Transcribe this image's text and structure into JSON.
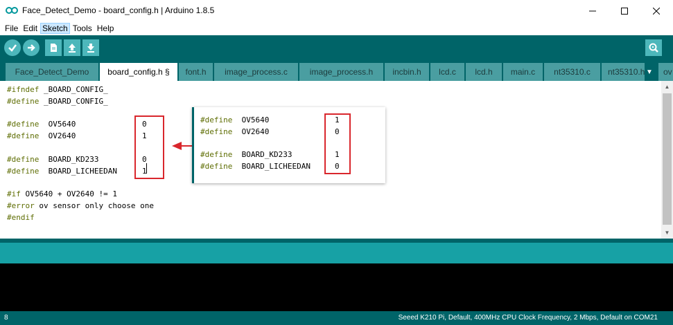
{
  "window": {
    "title": "Face_Detect_Demo - board_config.h | Arduino 1.8.5"
  },
  "menu": {
    "items": [
      "File",
      "Edit",
      "Sketch",
      "Tools",
      "Help"
    ]
  },
  "toolbar": {
    "verify_icon": "checkmark-icon",
    "upload_icon": "arrow-right-icon",
    "new_icon": "new-file-icon",
    "open_icon": "open-arrow-up-icon",
    "save_icon": "save-arrow-down-icon",
    "serial_icon": "serial-monitor-icon"
  },
  "tabs": [
    {
      "label": "Face_Detect_Demo"
    },
    {
      "label": "board_config.h §"
    },
    {
      "label": "font.h"
    },
    {
      "label": "image_process.c"
    },
    {
      "label": "image_process.h"
    },
    {
      "label": "incbin.h"
    },
    {
      "label": "lcd.c"
    },
    {
      "label": "lcd.h"
    },
    {
      "label": "main.c"
    },
    {
      "label": "nt35310.c"
    },
    {
      "label": "nt35310.h"
    },
    {
      "label": "ov"
    }
  ],
  "editor": {
    "lines": [
      {
        "pp": "#ifndef",
        "rest": " _BOARD_CONFIG_"
      },
      {
        "pp": "#define",
        "rest": " _BOARD_CONFIG_"
      },
      {
        "pp": "",
        "rest": ""
      },
      {
        "pp": "#define",
        "rest": "  OV5640"
      },
      {
        "pp": "#define",
        "rest": "  OV2640"
      },
      {
        "pp": "",
        "rest": ""
      },
      {
        "pp": "#define",
        "rest": "  BOARD_KD233"
      },
      {
        "pp": "#define",
        "rest": "  BOARD_LICHEEDAN"
      },
      {
        "pp": "",
        "rest": ""
      },
      {
        "pp": "#if",
        "rest": " OV5640 + OV2640 != 1"
      },
      {
        "pp": "#error",
        "rest": " ov sensor only choose one"
      },
      {
        "pp": "#endif",
        "rest": ""
      }
    ],
    "values": {
      "ov5640": "0",
      "ov2640": "1",
      "kd233": "0",
      "licheedan": "1"
    }
  },
  "popup": {
    "lines": [
      {
        "pp": "#define",
        "rest": "  OV5640"
      },
      {
        "pp": "#define",
        "rest": "  OV2640"
      },
      {
        "pp": "",
        "rest": ""
      },
      {
        "pp": "#define",
        "rest": "  BOARD_KD233"
      },
      {
        "pp": "#define",
        "rest": "  BOARD_LICHEEDAN"
      }
    ],
    "values": {
      "ov5640": "1",
      "ov2640": "0",
      "kd233": "1",
      "licheedan": "0"
    }
  },
  "status": {
    "line_number": "8",
    "board_info": "Seeed K210 Pi, Default, 400MHz CPU Clock Frequency, 2 Mbps, Default on COM21"
  },
  "colors": {
    "teal_dark": "#006468",
    "teal_light": "#17a1a5",
    "annotation_red": "#d9262c",
    "preprocessor": "#5e6d03"
  }
}
